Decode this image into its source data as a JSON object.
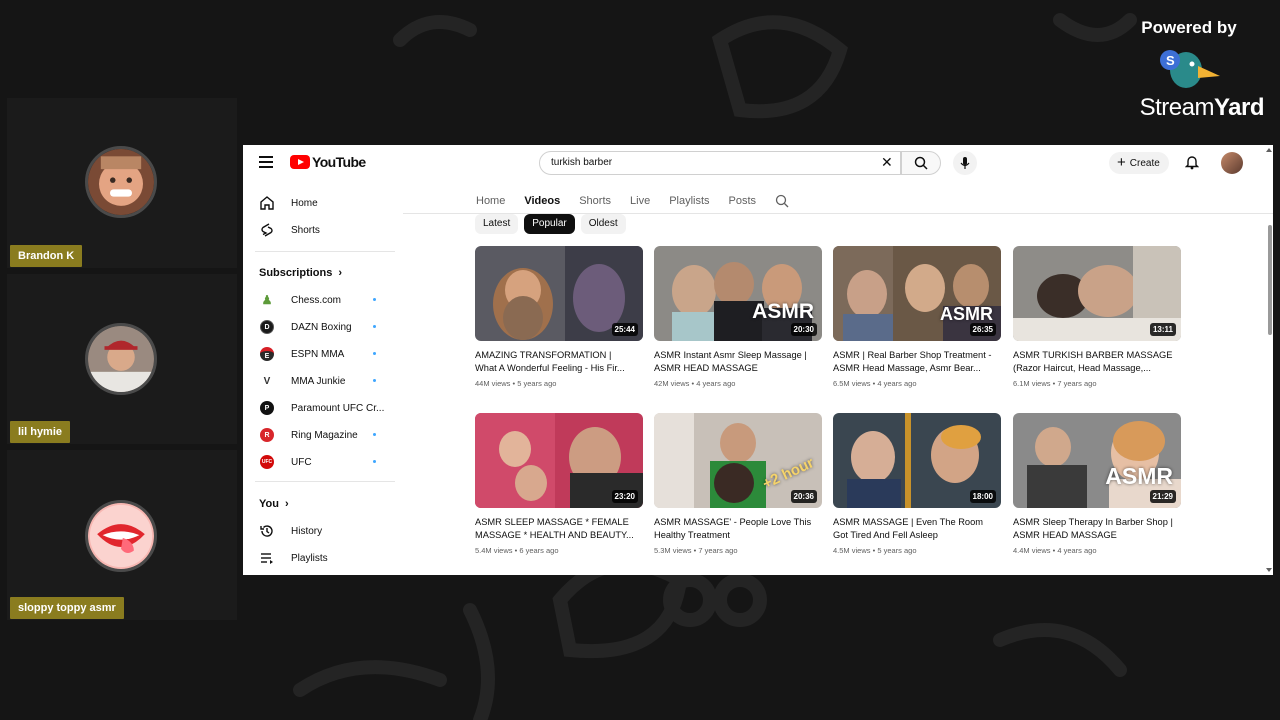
{
  "branding": {
    "powered_by": "Powered by",
    "name_light": "Stream",
    "name_bold": "Yard"
  },
  "participants": [
    {
      "name": "Brandon K"
    },
    {
      "name": "lil hymie"
    },
    {
      "name": "sloppy toppy asmr"
    }
  ],
  "youtube": {
    "logo_text": "YouTube",
    "search": {
      "value": "turkish barber"
    },
    "create_label": "Create",
    "guide": {
      "main": [
        {
          "label": "Home",
          "icon": "home-icon"
        },
        {
          "label": "Shorts",
          "icon": "shorts-icon"
        }
      ],
      "subscriptions_title": "Subscriptions",
      "subscriptions": [
        {
          "label": "Chess.com",
          "color": "#ffffff",
          "mark": "♟"
        },
        {
          "label": "DAZN Boxing",
          "color": "#1a1a1a",
          "mark": "D"
        },
        {
          "label": "ESPN MMA",
          "color": "#2a2a2a",
          "mark": "E"
        },
        {
          "label": "MMA Junkie",
          "color": "#ffffff",
          "mark": "V"
        },
        {
          "label": "Paramount UFC Cr...",
          "color": "#111111",
          "mark": "P"
        },
        {
          "label": "Ring Magazine",
          "color": "#d8262b",
          "mark": "R"
        },
        {
          "label": "UFC",
          "color": "#d20a0a",
          "mark": "UFC"
        }
      ],
      "you_title": "You",
      "you_items": [
        {
          "label": "History",
          "icon": "history-icon"
        },
        {
          "label": "Playlists",
          "icon": "playlists-icon"
        }
      ]
    },
    "tabs": [
      {
        "label": "Home",
        "active": false
      },
      {
        "label": "Videos",
        "active": true
      },
      {
        "label": "Shorts",
        "active": false
      },
      {
        "label": "Live",
        "active": false
      },
      {
        "label": "Playlists",
        "active": false
      },
      {
        "label": "Posts",
        "active": false
      }
    ],
    "chips": [
      {
        "label": "Latest",
        "active": false
      },
      {
        "label": "Popular",
        "active": true
      },
      {
        "label": "Oldest",
        "active": false
      }
    ],
    "videos": [
      {
        "title": "AMAZING TRANSFORMATION | What A Wonderful Feeling - His Fir...",
        "views": "44M views",
        "age": "5 years ago",
        "duration": "25:44",
        "overlay": ""
      },
      {
        "title": "ASMR Instant Asmr Sleep Massage | ASMR HEAD MASSAGE",
        "views": "42M views",
        "age": "4 years ago",
        "duration": "20:30",
        "overlay": "ASMR"
      },
      {
        "title": "ASMR | Real Barber Shop Treatment - ASMR Head Massage, Asmr Bear...",
        "views": "6.5M views",
        "age": "4 years ago",
        "duration": "26:35",
        "overlay": "ASMR"
      },
      {
        "title": "ASMR TURKISH BARBER MASSAGE (Razor Haircut, Head Massage,...",
        "views": "6.1M views",
        "age": "7 years ago",
        "duration": "13:11",
        "overlay": ""
      },
      {
        "title": "ASMR SLEEP MASSAGE * FEMALE MASSAGE * HEALTH AND BEAUTY...",
        "views": "5.4M views",
        "age": "6 years ago",
        "duration": "23:20",
        "overlay": ""
      },
      {
        "title": "ASMR MASSAGE' - People Love This Healthy Treatment",
        "views": "5.3M views",
        "age": "7 years ago",
        "duration": "20:36",
        "overlay": "+2 hour"
      },
      {
        "title": "ASMR MASSAGE | Even The Room Got Tired And Fell Asleep",
        "views": "4.5M views",
        "age": "5 years ago",
        "duration": "18:00",
        "overlay": ""
      },
      {
        "title": "ASMR Sleep Therapy In Barber Shop | ASMR HEAD MASSAGE",
        "views": "4.4M views",
        "age": "4 years ago",
        "duration": "21:29",
        "overlay": "ASMR"
      }
    ]
  }
}
